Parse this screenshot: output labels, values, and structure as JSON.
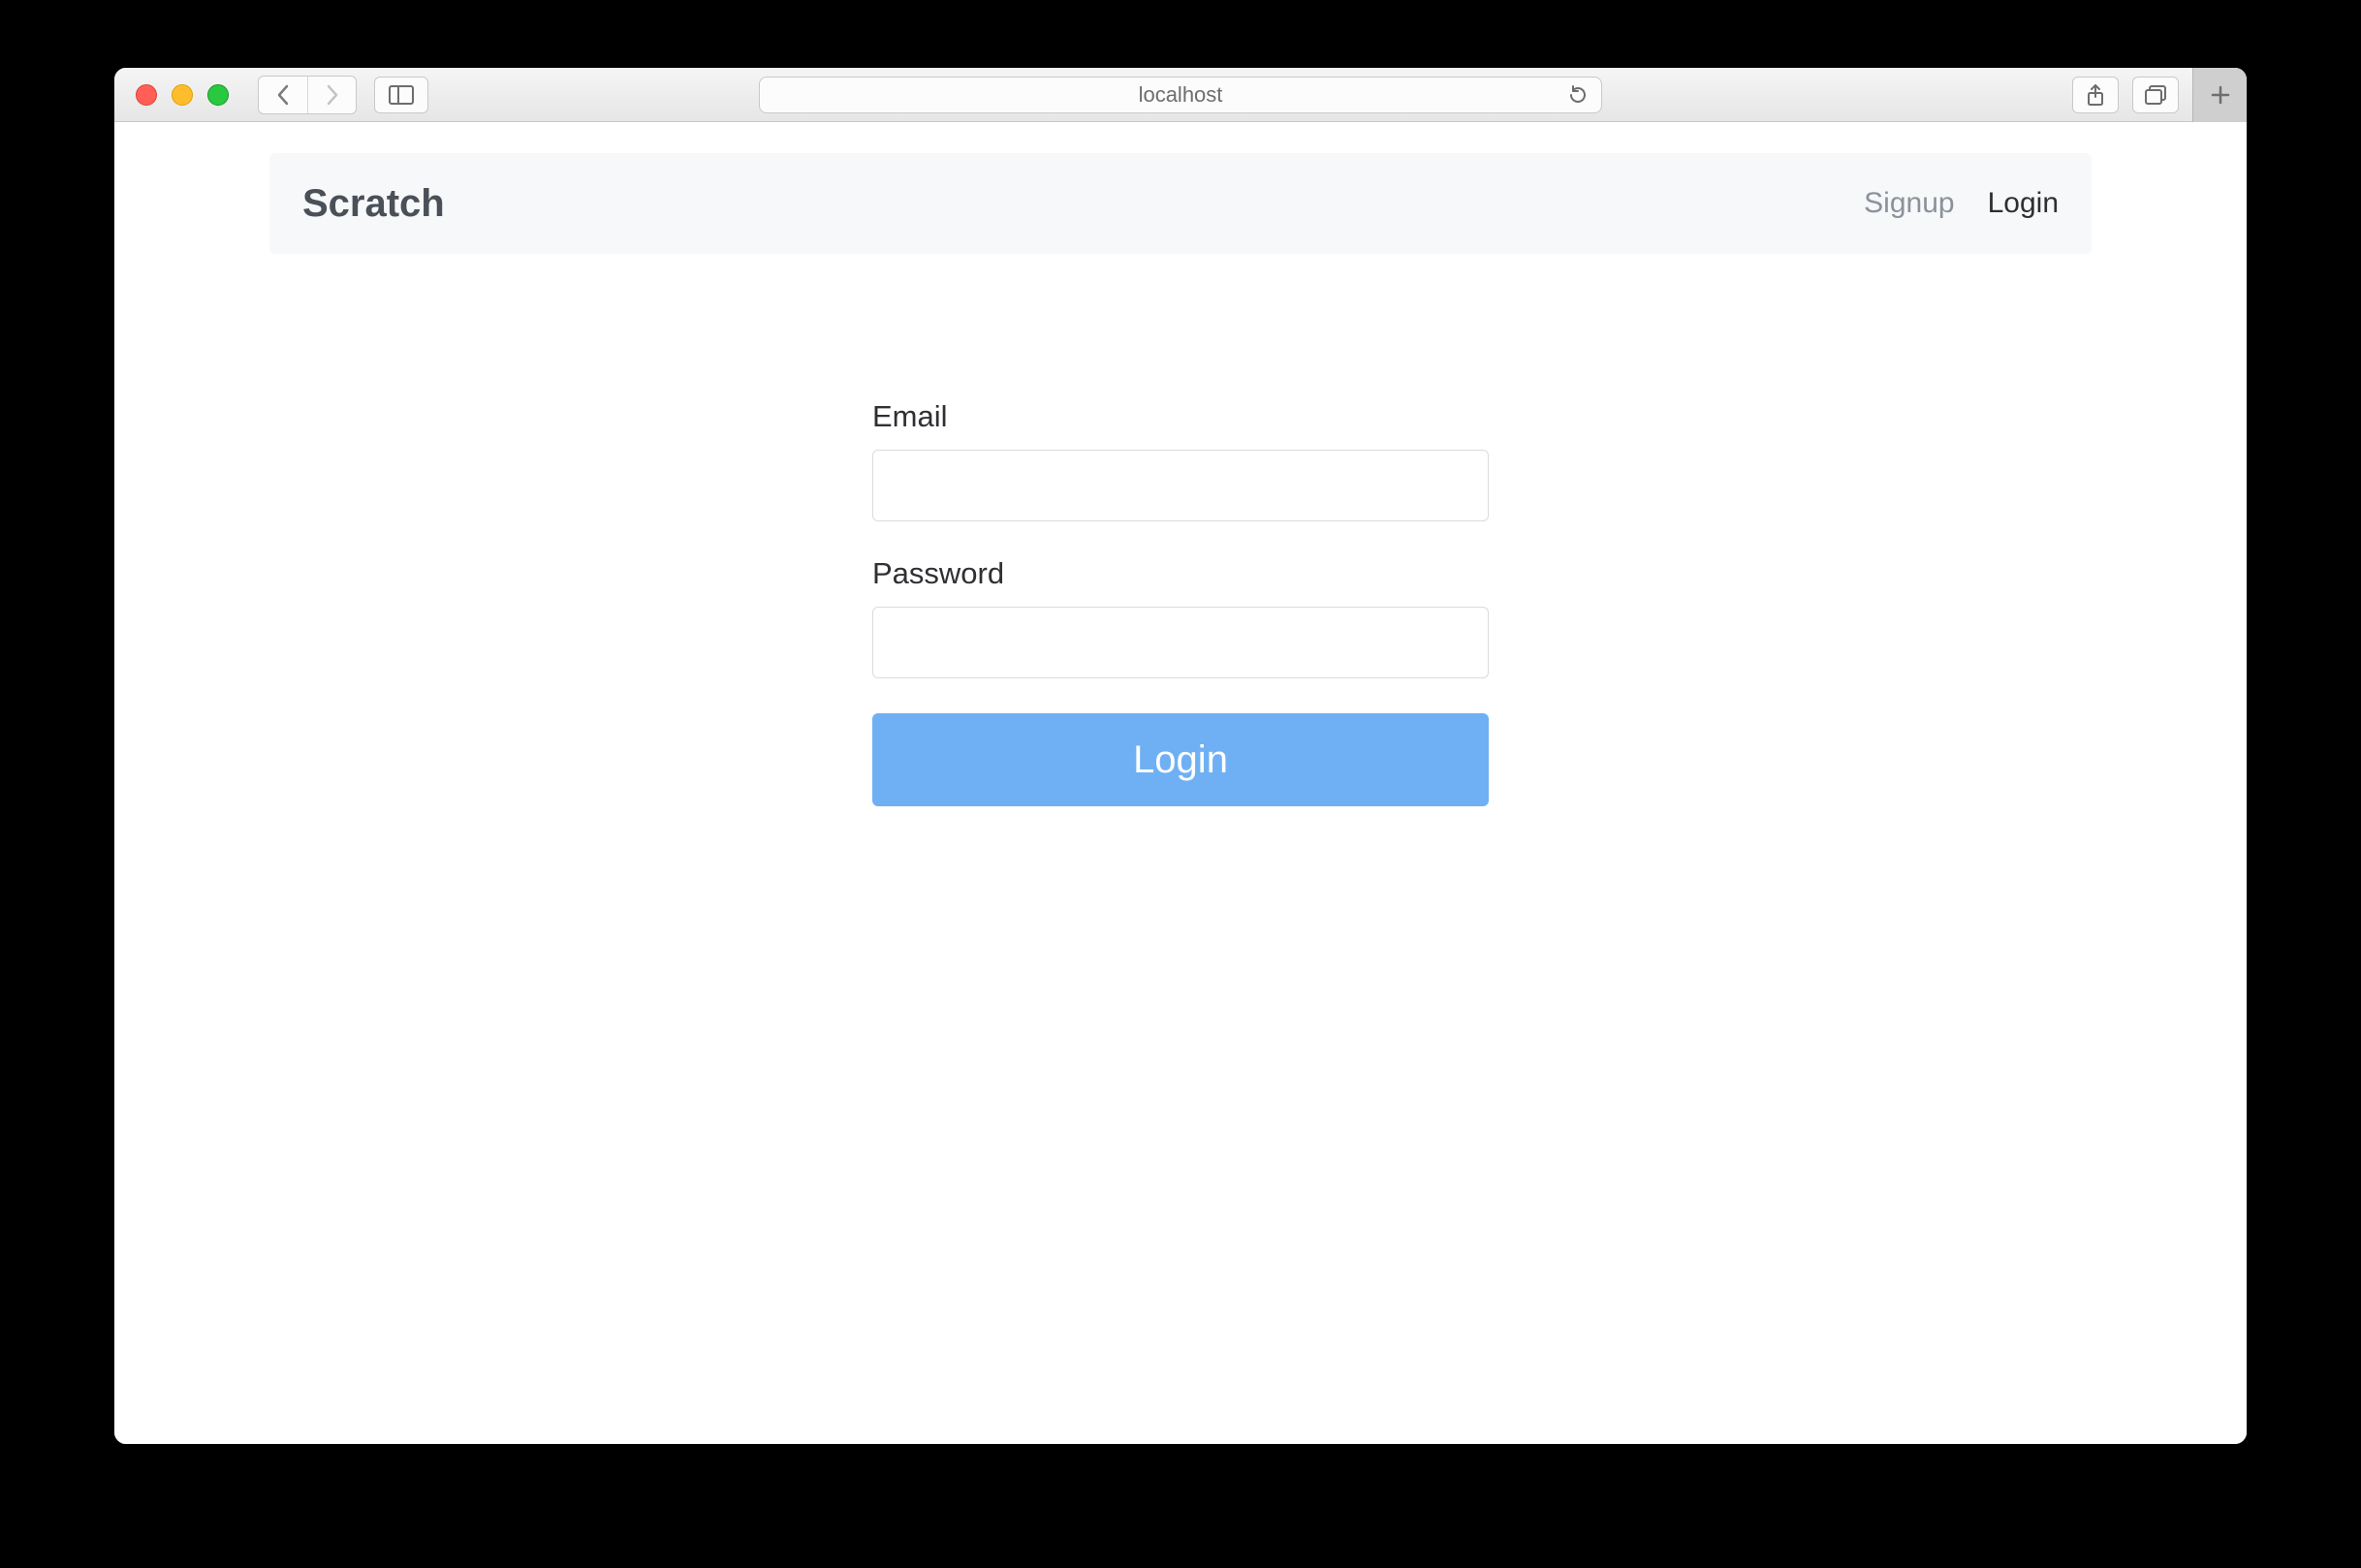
{
  "browser": {
    "url": "localhost"
  },
  "nav": {
    "brand": "Scratch",
    "signup": "Signup",
    "login": "Login"
  },
  "form": {
    "email_label": "Email",
    "email_value": "",
    "password_label": "Password",
    "password_value": "",
    "submit_label": "Login"
  }
}
